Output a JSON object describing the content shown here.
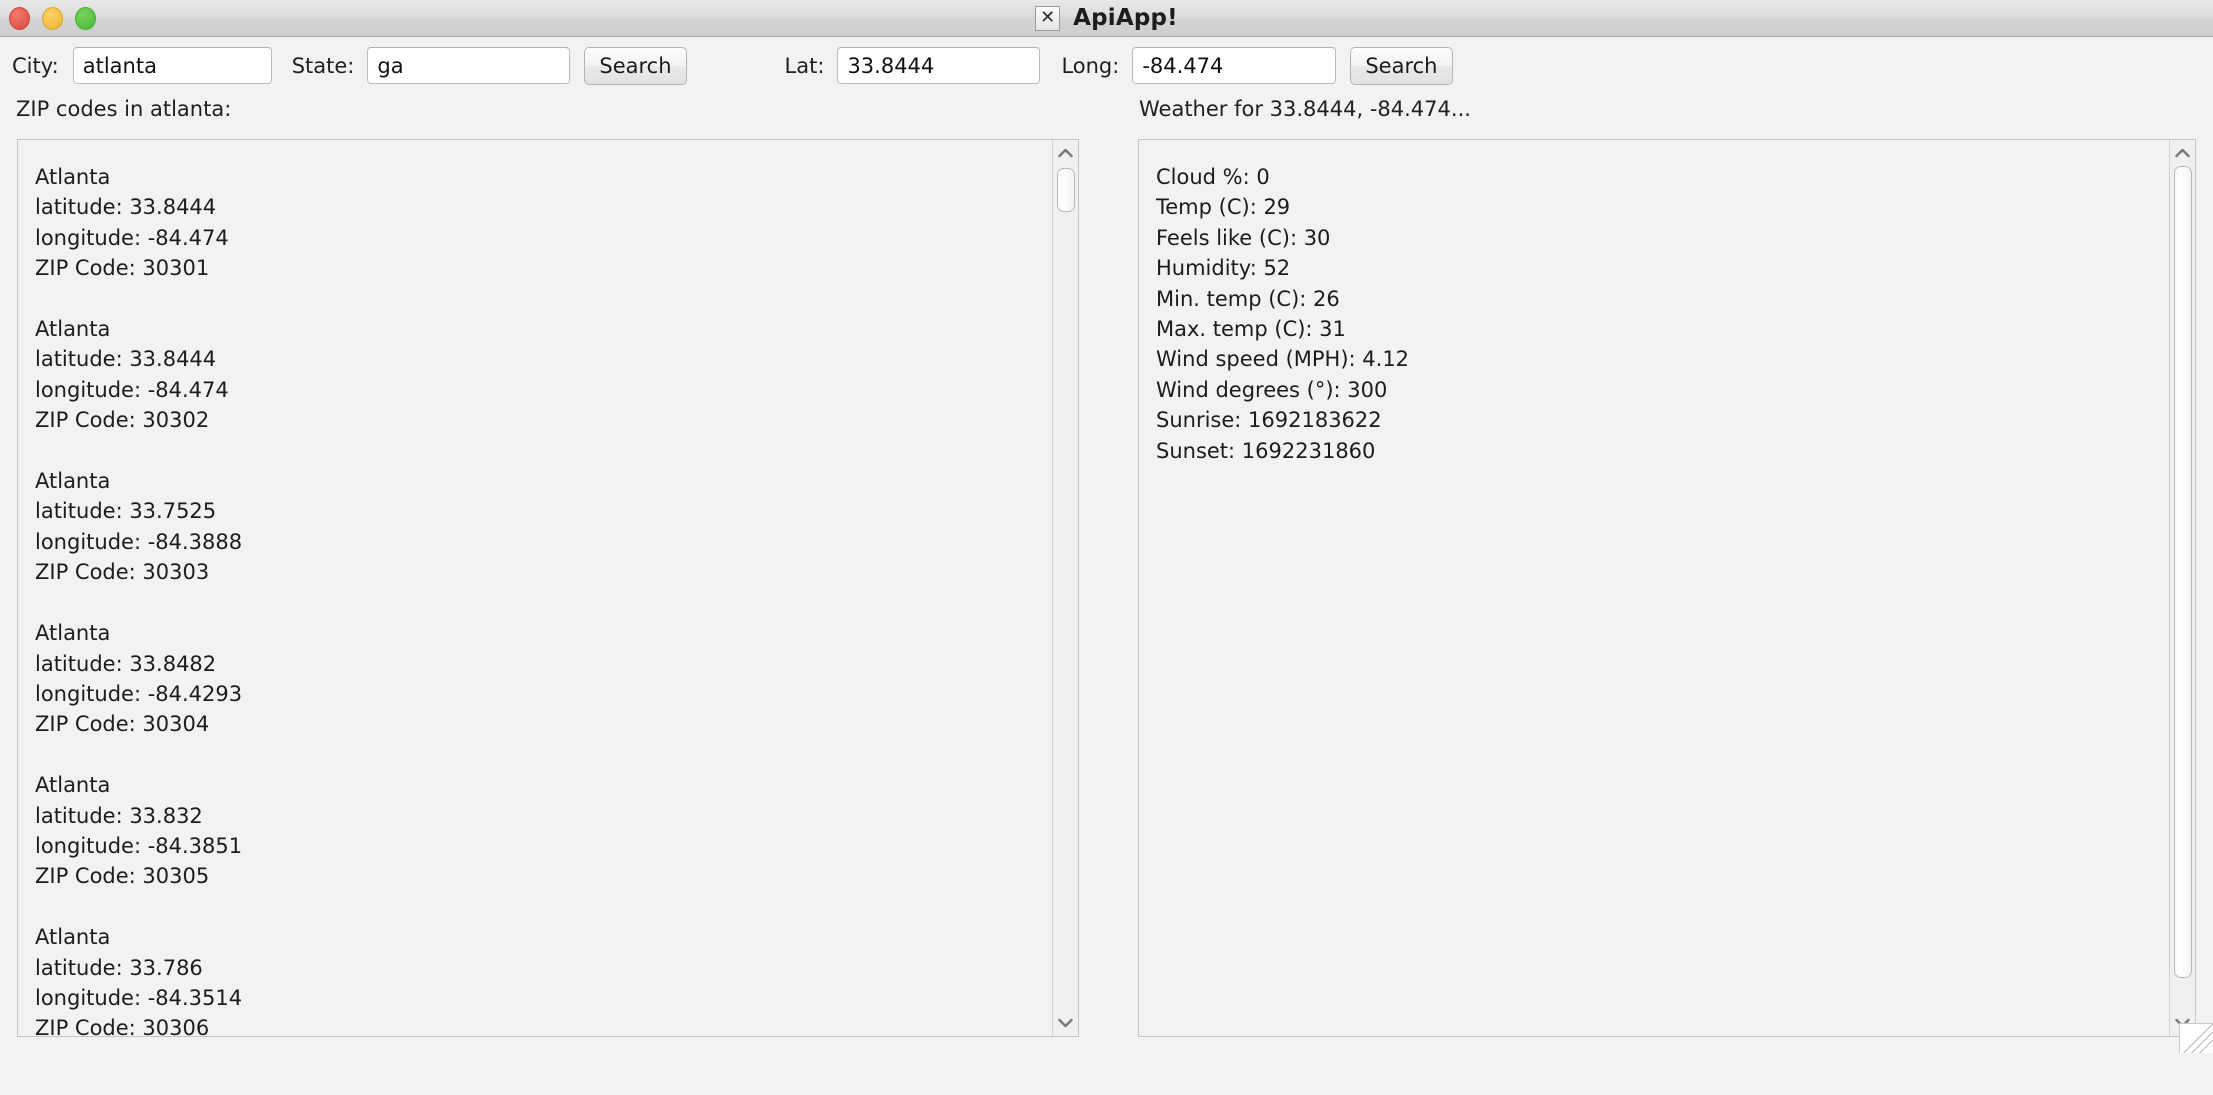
{
  "window": {
    "title": "ApiApp!",
    "icon": "x-window-icon",
    "controls": {
      "close": "close-button",
      "minimize": "minimize-button",
      "maximize": "maximize-button"
    }
  },
  "toolbar": {
    "city_label": "City:",
    "city_value": "atlanta",
    "city_placeholder": "",
    "state_label": "State:",
    "state_value": "ga",
    "state_placeholder": "",
    "zip_search_label": "Search",
    "lat_label": "Lat:",
    "lat_value": "33.8444",
    "lat_placeholder": "",
    "long_label": "Long:",
    "long_value": "-84.474",
    "long_placeholder": "",
    "weather_search_label": "Search"
  },
  "status": {
    "left": "ZIP codes in atlanta:",
    "right": "Weather for 33.8444, -84.474..."
  },
  "zip_panel": {
    "text": "Atlanta\nlatitude: 33.8444\nlongitude: -84.474\nZIP Code: 30301\n\nAtlanta\nlatitude: 33.8444\nlongitude: -84.474\nZIP Code: 30302\n\nAtlanta\nlatitude: 33.7525\nlongitude: -84.3888\nZIP Code: 30303\n\nAtlanta\nlatitude: 33.8482\nlongitude: -84.4293\nZIP Code: 30304\n\nAtlanta\nlatitude: 33.832\nlongitude: -84.3851\nZIP Code: 30305\n\nAtlanta\nlatitude: 33.786\nlongitude: -84.3514\nZIP Code: 30306",
    "entries": [
      {
        "city": "Atlanta",
        "latitude": "33.8444",
        "longitude": "-84.474",
        "zip": "30301"
      },
      {
        "city": "Atlanta",
        "latitude": "33.8444",
        "longitude": "-84.474",
        "zip": "30302"
      },
      {
        "city": "Atlanta",
        "latitude": "33.7525",
        "longitude": "-84.3888",
        "zip": "30303"
      },
      {
        "city": "Atlanta",
        "latitude": "33.8482",
        "longitude": "-84.4293",
        "zip": "30304"
      },
      {
        "city": "Atlanta",
        "latitude": "33.832",
        "longitude": "-84.3851",
        "zip": "30305"
      },
      {
        "city": "Atlanta",
        "latitude": "33.786",
        "longitude": "-84.3514",
        "zip": "30306"
      }
    ]
  },
  "weather_panel": {
    "text": "Cloud %: 0\nTemp (C): 29\nFeels like (C): 30\nHumidity: 52\nMin. temp (C): 26\nMax. temp (C): 31\nWind speed (MPH): 4.12\nWind degrees (°): 300\nSunrise: 1692183622\nSunset: 1692231860",
    "rows": [
      {
        "label": "Cloud %",
        "value": "0"
      },
      {
        "label": "Temp (C)",
        "value": "29"
      },
      {
        "label": "Feels like (C)",
        "value": "30"
      },
      {
        "label": "Humidity",
        "value": "52"
      },
      {
        "label": "Min. temp (C)",
        "value": "26"
      },
      {
        "label": "Max. temp (C)",
        "value": "31"
      },
      {
        "label": "Wind speed (MPH)",
        "value": "4.12"
      },
      {
        "label": "Wind degrees (°)",
        "value": "300"
      },
      {
        "label": "Sunrise",
        "value": "1692183622"
      },
      {
        "label": "Sunset",
        "value": "1692231860"
      }
    ]
  },
  "colors": {
    "close": "#e2574b",
    "minimize": "#f3bd40",
    "maximize": "#55c23f",
    "window_bg": "#f2f2f2",
    "panel_border": "#c6c6c6",
    "text": "#1c1c1c"
  }
}
